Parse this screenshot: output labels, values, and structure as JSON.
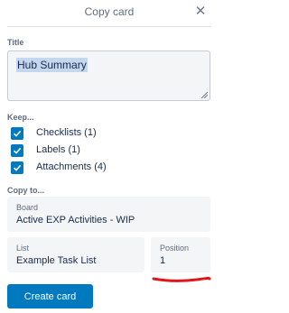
{
  "header": {
    "title": "Copy card",
    "close_icon": "close-icon"
  },
  "title_section": {
    "label": "Title",
    "value": "Hub Summary"
  },
  "keep_section": {
    "label": "Keep...",
    "items": [
      {
        "label": "Checklists (1)",
        "checked": true
      },
      {
        "label": "Labels (1)",
        "checked": true
      },
      {
        "label": "Attachments (4)",
        "checked": true
      }
    ]
  },
  "copy_to": {
    "label": "Copy to...",
    "board": {
      "label": "Board",
      "value": "Active EXP Activities - WIP"
    },
    "list": {
      "label": "List",
      "value": "Example Task List"
    },
    "position": {
      "label": "Position",
      "value": "1"
    }
  },
  "create_button": {
    "label": "Create card"
  },
  "colors": {
    "accent": "#0079bf",
    "annotation": "#e0161b"
  }
}
